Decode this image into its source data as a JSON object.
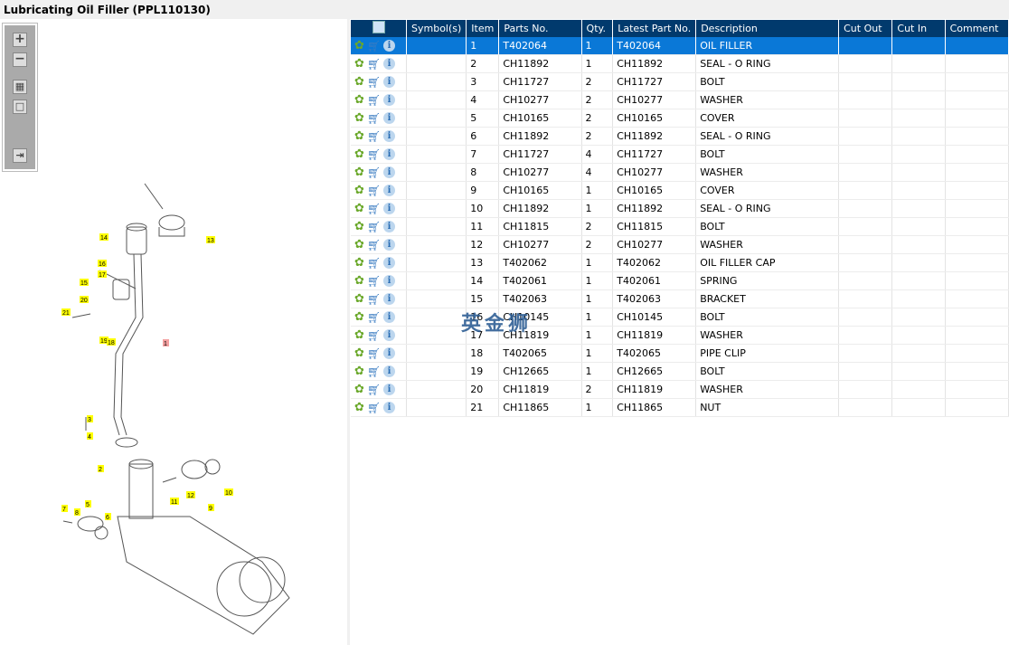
{
  "title": "Lubricating Oil Filler (PPL110130)",
  "toolbar": {
    "zoom_in": "+",
    "zoom_out": "−",
    "fit": "▦",
    "actual": "□",
    "export": "⇥"
  },
  "columns": [
    "Symbol(s)",
    "Item",
    "Parts No.",
    "Qty.",
    "Latest Part No.",
    "Description",
    "Cut Out",
    "Cut In",
    "Comment"
  ],
  "rows": [
    [
      "1",
      "T402064",
      "1",
      "T402064",
      "OIL FILLER"
    ],
    [
      "2",
      "CH11892",
      "1",
      "CH11892",
      "SEAL - O RING"
    ],
    [
      "3",
      "CH11727",
      "2",
      "CH11727",
      "BOLT"
    ],
    [
      "4",
      "CH10277",
      "2",
      "CH10277",
      "WASHER"
    ],
    [
      "5",
      "CH10165",
      "2",
      "CH10165",
      "COVER"
    ],
    [
      "6",
      "CH11892",
      "2",
      "CH11892",
      "SEAL - O RING"
    ],
    [
      "7",
      "CH11727",
      "4",
      "CH11727",
      "BOLT"
    ],
    [
      "8",
      "CH10277",
      "4",
      "CH10277",
      "WASHER"
    ],
    [
      "9",
      "CH10165",
      "1",
      "CH10165",
      "COVER"
    ],
    [
      "10",
      "CH11892",
      "1",
      "CH11892",
      "SEAL - O RING"
    ],
    [
      "11",
      "CH11815",
      "2",
      "CH11815",
      "BOLT"
    ],
    [
      "12",
      "CH10277",
      "2",
      "CH10277",
      "WASHER"
    ],
    [
      "13",
      "T402062",
      "1",
      "T402062",
      "OIL FILLER CAP"
    ],
    [
      "14",
      "T402061",
      "1",
      "T402061",
      "SPRING"
    ],
    [
      "15",
      "T402063",
      "1",
      "T402063",
      "BRACKET"
    ],
    [
      "16",
      "CH10145",
      "1",
      "CH10145",
      "BOLT"
    ],
    [
      "17",
      "CH11819",
      "1",
      "CH11819",
      "WASHER"
    ],
    [
      "18",
      "T402065",
      "1",
      "T402065",
      "PIPE CLIP"
    ],
    [
      "19",
      "CH12665",
      "1",
      "CH12665",
      "BOLT"
    ],
    [
      "20",
      "CH11819",
      "2",
      "CH11819",
      "WASHER"
    ],
    [
      "21",
      "CH11865",
      "1",
      "CH11865",
      "NUT"
    ]
  ],
  "selected_row": 0,
  "watermark": "英金狮",
  "callouts": [
    "14",
    "13",
    "16",
    "17",
    "15",
    "20",
    "21",
    "19",
    "18",
    "1",
    "3",
    "4",
    "2",
    "11",
    "12",
    "9",
    "10",
    "7",
    "8",
    "5",
    "6"
  ]
}
